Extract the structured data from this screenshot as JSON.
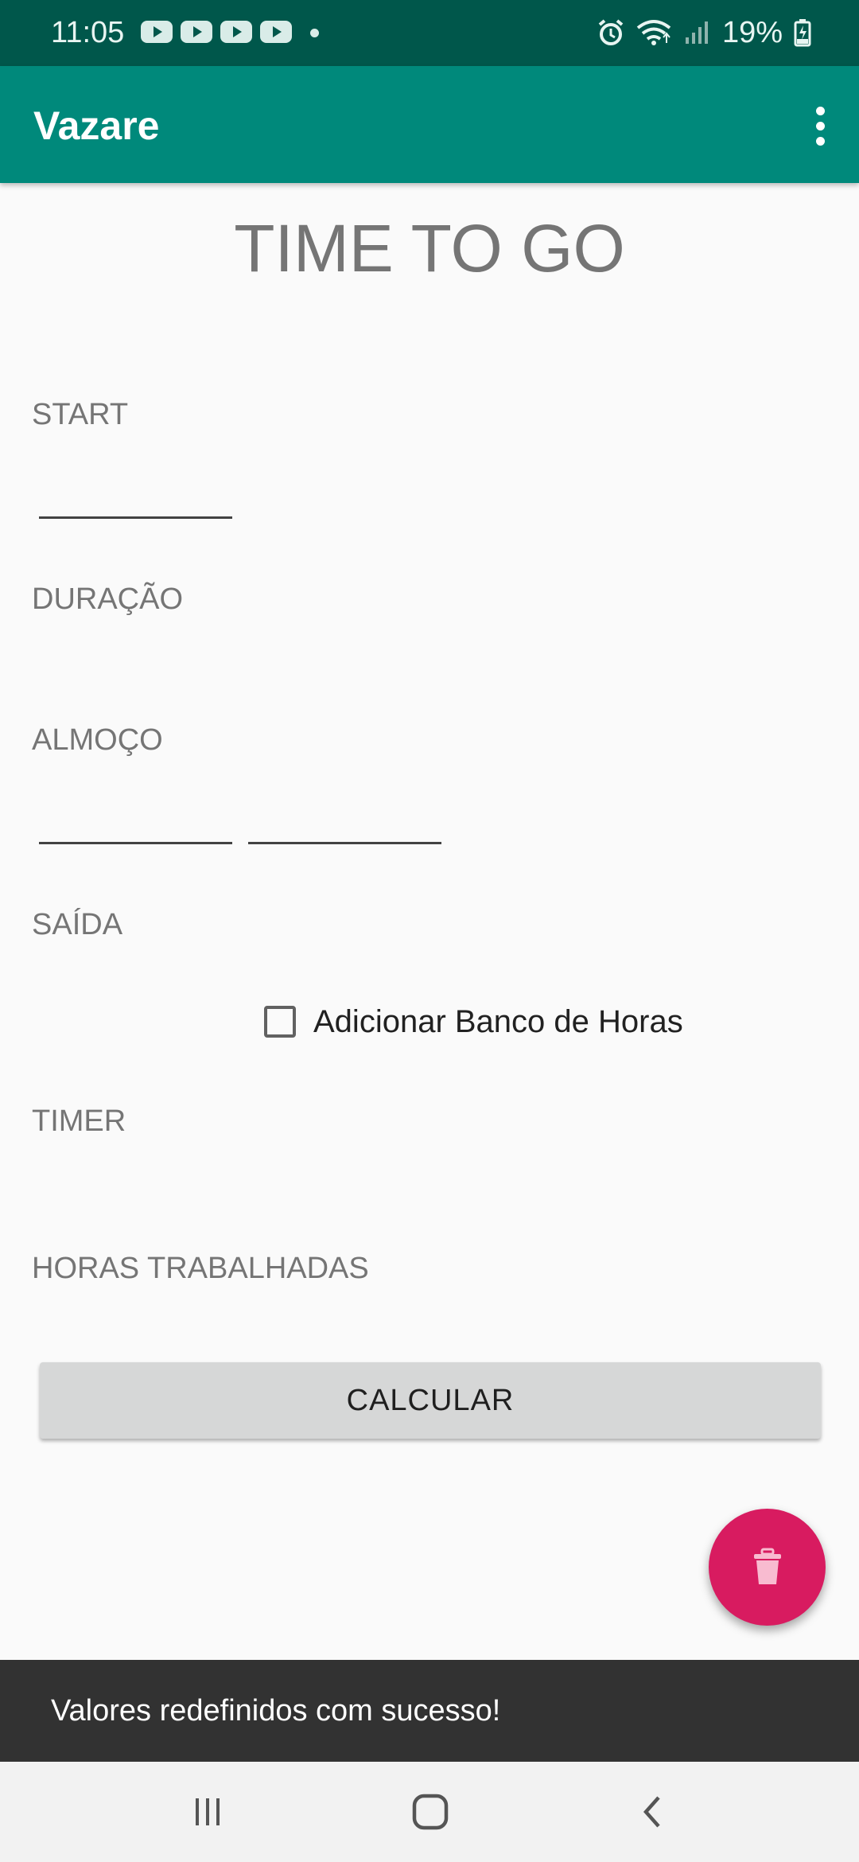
{
  "status_bar": {
    "time": "11:05",
    "battery_percent": "19%",
    "notification_icons": [
      "youtube-icon",
      "youtube-icon",
      "youtube-icon",
      "youtube-icon"
    ],
    "right_icons": [
      "alarm-icon",
      "wifi-icon",
      "signal-icon",
      "battery-charging-icon"
    ]
  },
  "app_bar": {
    "title": "Vazare",
    "menu_icon": "more-vert-icon"
  },
  "main": {
    "heading": "TIME TO GO",
    "start_label": "START",
    "start_value": "",
    "duracao_label": "DURAÇÃO",
    "almoco_label": "ALMOÇO",
    "almoco_start_value": "",
    "almoco_end_value": "",
    "saida_label": "SAÍDA",
    "checkbox_label": "Adicionar Banco de Horas",
    "checkbox_checked": false,
    "timer_label": "TIMER",
    "horas_label": "HORAS TRABALHADAS",
    "calc_button": "CALCULAR"
  },
  "fab": {
    "icon": "trash-icon",
    "color": "#d81b60"
  },
  "snackbar": {
    "message": "Valores redefinidos com sucesso!"
  },
  "nav_bar": {
    "icons": [
      "recents-icon",
      "home-icon",
      "back-icon"
    ]
  },
  "colors": {
    "status_bar": "#00574b",
    "app_bar": "#00897b",
    "accent": "#d81b60",
    "background": "#fafafa"
  }
}
